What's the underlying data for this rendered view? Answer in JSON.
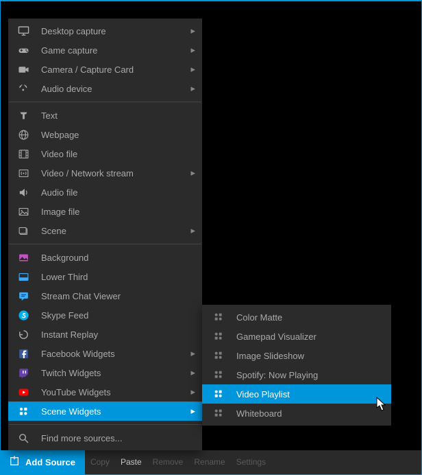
{
  "footer": {
    "add_source": "Add Source",
    "actions": [
      "Copy",
      "Paste",
      "Remove",
      "Rename",
      "Settings"
    ],
    "enabled_index": 1
  },
  "menu": {
    "groups": [
      [
        {
          "icon": "monitor-icon",
          "label": "Desktop capture",
          "submenu": true
        },
        {
          "icon": "gamepad-icon",
          "label": "Game capture",
          "submenu": true
        },
        {
          "icon": "camera-icon",
          "label": "Camera / Capture Card",
          "submenu": true
        },
        {
          "icon": "audio-icon",
          "label": "Audio device",
          "submenu": true
        }
      ],
      [
        {
          "icon": "text-icon",
          "label": "Text",
          "submenu": false
        },
        {
          "icon": "globe-icon",
          "label": "Webpage",
          "submenu": false
        },
        {
          "icon": "film-icon",
          "label": "Video file",
          "submenu": false
        },
        {
          "icon": "stream-icon",
          "label": "Video / Network stream",
          "submenu": true
        },
        {
          "icon": "speaker-icon",
          "label": "Audio file",
          "submenu": false
        },
        {
          "icon": "image-icon",
          "label": "Image file",
          "submenu": false
        },
        {
          "icon": "scene-icon",
          "label": "Scene",
          "submenu": true
        }
      ],
      [
        {
          "icon": "background-icon",
          "label": "Background",
          "submenu": false,
          "tint": "#c84fc8"
        },
        {
          "icon": "lowerthird-icon",
          "label": "Lower Third",
          "submenu": false,
          "tint": "#3fa9f5"
        },
        {
          "icon": "chat-icon",
          "label": "Stream Chat Viewer",
          "submenu": false,
          "tint": "#3fa9f5"
        },
        {
          "icon": "skype-icon",
          "label": "Skype Feed",
          "submenu": false,
          "tint": "#00aff0"
        },
        {
          "icon": "replay-icon",
          "label": "Instant Replay",
          "submenu": false
        },
        {
          "icon": "facebook-icon",
          "label": "Facebook Widgets",
          "submenu": true,
          "tint": "#3b5998"
        },
        {
          "icon": "twitch-icon",
          "label": "Twitch Widgets",
          "submenu": true,
          "tint": "#6441a5"
        },
        {
          "icon": "youtube-icon",
          "label": "YouTube Widgets",
          "submenu": true,
          "tint": "#ff0000"
        },
        {
          "icon": "widgets-icon",
          "label": "Scene Widgets",
          "submenu": true,
          "highlight": true
        }
      ],
      [
        {
          "icon": "search-icon",
          "label": "Find more sources...",
          "submenu": false
        }
      ]
    ]
  },
  "submenu": {
    "items": [
      {
        "label": "Color Matte"
      },
      {
        "label": "Gamepad Visualizer"
      },
      {
        "label": "Image Slideshow"
      },
      {
        "label": "Spotify: Now Playing"
      },
      {
        "label": "Video Playlist",
        "highlight": true
      },
      {
        "label": "Whiteboard"
      }
    ]
  },
  "colors": {
    "accent": "#0096dc",
    "panel": "#2b2b2b",
    "text": "#a9a9a9"
  }
}
